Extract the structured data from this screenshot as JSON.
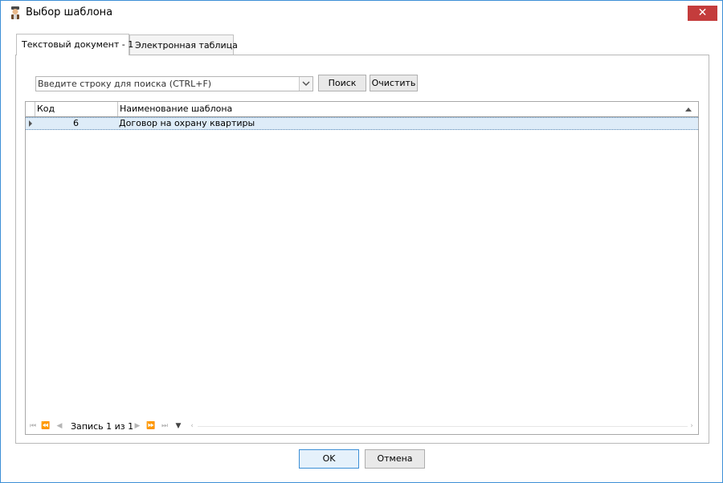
{
  "window": {
    "title": "Выбор шаблона",
    "close_glyph": "✕"
  },
  "tabs": [
    {
      "label": "Текстовый документ - 1",
      "active": true
    },
    {
      "label": "Электронная таблица",
      "active": false
    }
  ],
  "search": {
    "placeholder": "Введите строку для поиска (CTRL+F)",
    "search_label": "Поиск",
    "clear_label": "Очистить"
  },
  "grid": {
    "columns": [
      "Код",
      "Наименование шаблона"
    ],
    "rows": [
      {
        "code": "6",
        "name": "Договор на охрану квартиры"
      }
    ]
  },
  "navigator": {
    "record_text": "Запись 1 из 1"
  },
  "footer": {
    "ok_label": "OK",
    "cancel_label": "Отмена"
  },
  "colors": {
    "accent": "#3c8fd6",
    "close": "#c43c3c",
    "selected_row": "#deecf8"
  }
}
